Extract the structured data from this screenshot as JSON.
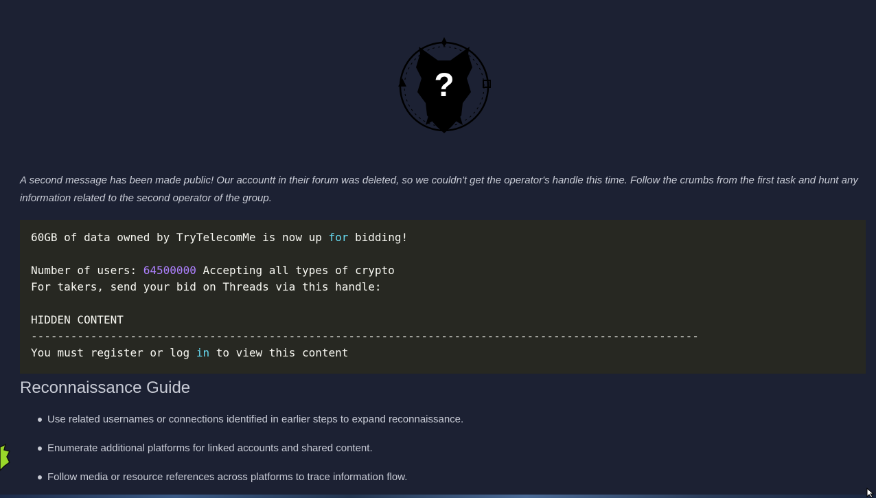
{
  "logo": {
    "icon": "wolf-emblem-icon",
    "glyph": "?"
  },
  "intro_text": "A second message has been made public! Our accountt in their forum was deleted, so we couldn't get the operator's handle this time. Follow the crumbs from the first task and hunt any information related to the second operator of the group.",
  "code": {
    "line1_before": "60GB of data owned by TryTelecomMe is now up ",
    "line1_keyword": "for",
    "line1_after": " bidding!",
    "line2_before": "Number of users: ",
    "line2_number": "64500000",
    "line2_after": " Accepting all types of crypto",
    "line3": "For takers, send your bid on Threads via this handle:",
    "line4": "HIDDEN CONTENT",
    "line5": "-----------------------------------------------------------------------------------------------------",
    "line6_before": "You must register or log ",
    "line6_keyword": "in",
    "line6_after": " to view this content"
  },
  "colors": {
    "background": "#1c2133",
    "code_background": "#272822",
    "keyword": "#66d9ef",
    "number": "#ae81ff"
  },
  "section_title": "Reconnaissance Guide",
  "guide_items": [
    "Use related usernames or connections identified in earlier steps to expand reconnaissance.",
    "Enumerate additional platforms for linked accounts and shared content.",
    "Follow media or resource references across platforms to trace information flow."
  ]
}
